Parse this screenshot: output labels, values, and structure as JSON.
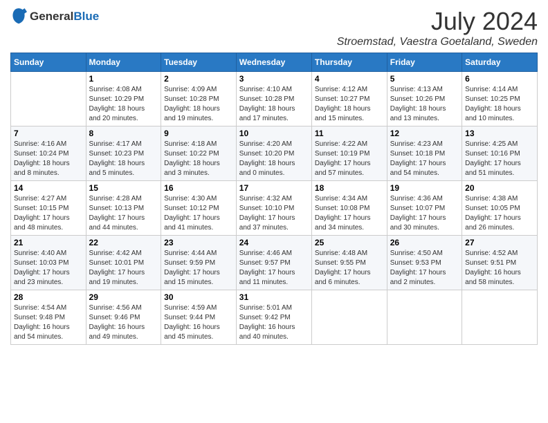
{
  "header": {
    "logo_general": "General",
    "logo_blue": "Blue",
    "month_title": "July 2024",
    "location": "Stroemstad, Vaestra Goetaland, Sweden"
  },
  "weekdays": [
    "Sunday",
    "Monday",
    "Tuesday",
    "Wednesday",
    "Thursday",
    "Friday",
    "Saturday"
  ],
  "weeks": [
    [
      {
        "day": "",
        "info": ""
      },
      {
        "day": "1",
        "info": "Sunrise: 4:08 AM\nSunset: 10:29 PM\nDaylight: 18 hours\nand 20 minutes."
      },
      {
        "day": "2",
        "info": "Sunrise: 4:09 AM\nSunset: 10:28 PM\nDaylight: 18 hours\nand 19 minutes."
      },
      {
        "day": "3",
        "info": "Sunrise: 4:10 AM\nSunset: 10:28 PM\nDaylight: 18 hours\nand 17 minutes."
      },
      {
        "day": "4",
        "info": "Sunrise: 4:12 AM\nSunset: 10:27 PM\nDaylight: 18 hours\nand 15 minutes."
      },
      {
        "day": "5",
        "info": "Sunrise: 4:13 AM\nSunset: 10:26 PM\nDaylight: 18 hours\nand 13 minutes."
      },
      {
        "day": "6",
        "info": "Sunrise: 4:14 AM\nSunset: 10:25 PM\nDaylight: 18 hours\nand 10 minutes."
      }
    ],
    [
      {
        "day": "7",
        "info": "Sunrise: 4:16 AM\nSunset: 10:24 PM\nDaylight: 18 hours\nand 8 minutes."
      },
      {
        "day": "8",
        "info": "Sunrise: 4:17 AM\nSunset: 10:23 PM\nDaylight: 18 hours\nand 5 minutes."
      },
      {
        "day": "9",
        "info": "Sunrise: 4:18 AM\nSunset: 10:22 PM\nDaylight: 18 hours\nand 3 minutes."
      },
      {
        "day": "10",
        "info": "Sunrise: 4:20 AM\nSunset: 10:20 PM\nDaylight: 18 hours\nand 0 minutes."
      },
      {
        "day": "11",
        "info": "Sunrise: 4:22 AM\nSunset: 10:19 PM\nDaylight: 17 hours\nand 57 minutes."
      },
      {
        "day": "12",
        "info": "Sunrise: 4:23 AM\nSunset: 10:18 PM\nDaylight: 17 hours\nand 54 minutes."
      },
      {
        "day": "13",
        "info": "Sunrise: 4:25 AM\nSunset: 10:16 PM\nDaylight: 17 hours\nand 51 minutes."
      }
    ],
    [
      {
        "day": "14",
        "info": "Sunrise: 4:27 AM\nSunset: 10:15 PM\nDaylight: 17 hours\nand 48 minutes."
      },
      {
        "day": "15",
        "info": "Sunrise: 4:28 AM\nSunset: 10:13 PM\nDaylight: 17 hours\nand 44 minutes."
      },
      {
        "day": "16",
        "info": "Sunrise: 4:30 AM\nSunset: 10:12 PM\nDaylight: 17 hours\nand 41 minutes."
      },
      {
        "day": "17",
        "info": "Sunrise: 4:32 AM\nSunset: 10:10 PM\nDaylight: 17 hours\nand 37 minutes."
      },
      {
        "day": "18",
        "info": "Sunrise: 4:34 AM\nSunset: 10:08 PM\nDaylight: 17 hours\nand 34 minutes."
      },
      {
        "day": "19",
        "info": "Sunrise: 4:36 AM\nSunset: 10:07 PM\nDaylight: 17 hours\nand 30 minutes."
      },
      {
        "day": "20",
        "info": "Sunrise: 4:38 AM\nSunset: 10:05 PM\nDaylight: 17 hours\nand 26 minutes."
      }
    ],
    [
      {
        "day": "21",
        "info": "Sunrise: 4:40 AM\nSunset: 10:03 PM\nDaylight: 17 hours\nand 23 minutes."
      },
      {
        "day": "22",
        "info": "Sunrise: 4:42 AM\nSunset: 10:01 PM\nDaylight: 17 hours\nand 19 minutes."
      },
      {
        "day": "23",
        "info": "Sunrise: 4:44 AM\nSunset: 9:59 PM\nDaylight: 17 hours\nand 15 minutes."
      },
      {
        "day": "24",
        "info": "Sunrise: 4:46 AM\nSunset: 9:57 PM\nDaylight: 17 hours\nand 11 minutes."
      },
      {
        "day": "25",
        "info": "Sunrise: 4:48 AM\nSunset: 9:55 PM\nDaylight: 17 hours\nand 6 minutes."
      },
      {
        "day": "26",
        "info": "Sunrise: 4:50 AM\nSunset: 9:53 PM\nDaylight: 17 hours\nand 2 minutes."
      },
      {
        "day": "27",
        "info": "Sunrise: 4:52 AM\nSunset: 9:51 PM\nDaylight: 16 hours\nand 58 minutes."
      }
    ],
    [
      {
        "day": "28",
        "info": "Sunrise: 4:54 AM\nSunset: 9:48 PM\nDaylight: 16 hours\nand 54 minutes."
      },
      {
        "day": "29",
        "info": "Sunrise: 4:56 AM\nSunset: 9:46 PM\nDaylight: 16 hours\nand 49 minutes."
      },
      {
        "day": "30",
        "info": "Sunrise: 4:59 AM\nSunset: 9:44 PM\nDaylight: 16 hours\nand 45 minutes."
      },
      {
        "day": "31",
        "info": "Sunrise: 5:01 AM\nSunset: 9:42 PM\nDaylight: 16 hours\nand 40 minutes."
      },
      {
        "day": "",
        "info": ""
      },
      {
        "day": "",
        "info": ""
      },
      {
        "day": "",
        "info": ""
      }
    ]
  ]
}
